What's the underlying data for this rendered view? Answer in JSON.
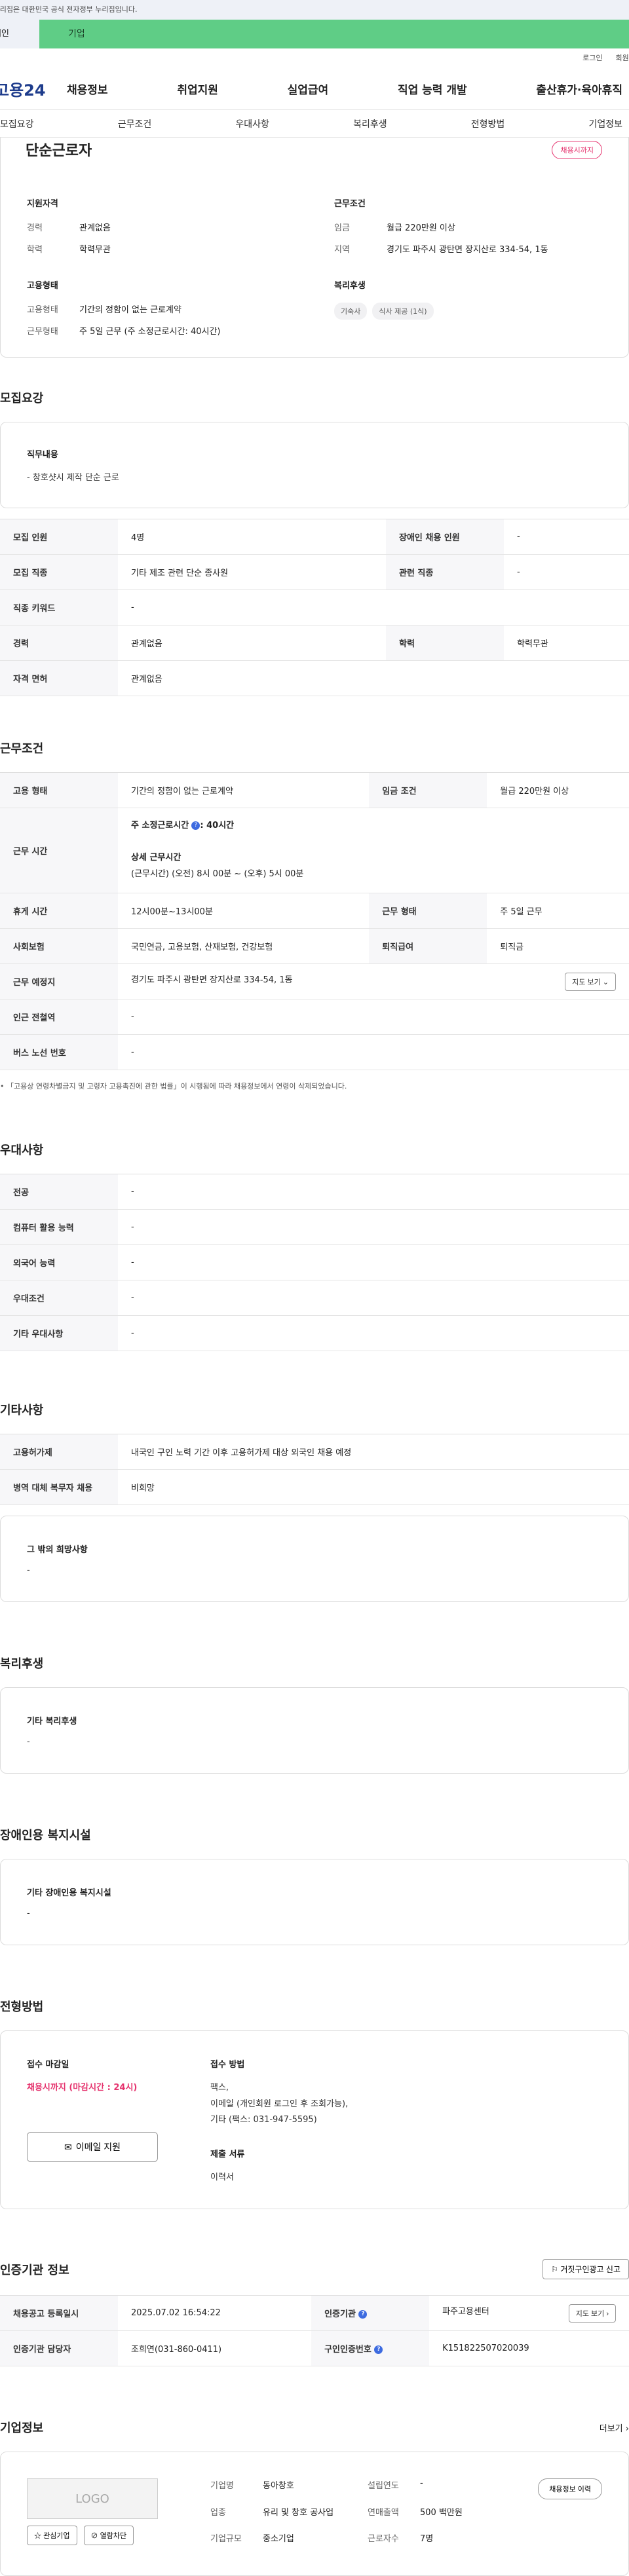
{
  "gov_banner": "이 누리집은 대한민국 공식 전자정부 누리집입니다.",
  "tabs": {
    "personal": "개인",
    "company": "기업"
  },
  "util": {
    "login": "로그인",
    "signup": "회원가입"
  },
  "logo": "고용24",
  "gnb": [
    "채용정보",
    "취업지원",
    "실업급여",
    "직업 능력 개발",
    "출산휴가·육아휴직"
  ],
  "subnav": [
    "모집요강",
    "근무조건",
    "우대사항",
    "복리후생",
    "전형방법",
    "기업정보"
  ],
  "summary": {
    "title": "단순근로자",
    "deadline_badge": "채용시까지",
    "qual_heading": "지원자격",
    "qual": [
      {
        "k": "경력",
        "v": "관계없음"
      },
      {
        "k": "학력",
        "v": "학력무관"
      }
    ],
    "cond_heading": "근무조건",
    "cond": [
      {
        "k": "임금",
        "v": "월급 220만원 이상"
      },
      {
        "k": "지역",
        "v": "경기도 파주시 광탄면 장지산로 334-54, 1동"
      }
    ],
    "emp_heading": "고용형태",
    "emp": [
      {
        "k": "고용형태",
        "v": "기간의 정함이 없는 근로계약"
      },
      {
        "k": "근무형태",
        "v": "주 5일 근무 (주 소정근로시간: 40시간)"
      }
    ],
    "welfare_heading": "복리후생",
    "welfare_chips": [
      "기숙사",
      "식사 제공 (1식)"
    ]
  },
  "recruit": {
    "heading": "모집요강",
    "job_desc_label": "직무내용",
    "job_desc": "- 창호샷시 제작 단순 근로",
    "rows": [
      {
        "k1": "모집 인원",
        "v1": "4명",
        "k2": "장애인 채용 인원",
        "v2": "-"
      },
      {
        "k1": "모집 직종",
        "v1": "기타 제조 관련 단순 종사원",
        "k2": "관련 직종",
        "v2": "-"
      },
      {
        "k1": "직종 키워드",
        "v1": "-"
      },
      {
        "k1": "경력",
        "v1": "관계없음",
        "k2": "학력",
        "v2": "학력무관"
      },
      {
        "k1": "자격 면허",
        "v1": "관계없음"
      }
    ]
  },
  "work": {
    "heading": "근무조건",
    "emp_type_k": "고용 형태",
    "emp_type_v": "기간의 정함이 없는 근로계약",
    "wage_k": "임금 조건",
    "wage_v": "월급 220만원 이상",
    "hours_k": "근무 시간",
    "hours_week": "주 소정근로시간",
    "hours_week_v": ": 40시간",
    "hours_detail_label": "상세 근무시간",
    "hours_detail": "(근무시간) (오전) 8시 00분 ~ (오후) 5시 00분",
    "break_k": "휴게 시간",
    "break_v": "12시00분~13시00분",
    "form_k": "근무 형태",
    "form_v": "주 5일 근무",
    "ins_k": "사회보험",
    "ins_v": "국민연금, 고용보험, 산재보험, 건강보험",
    "retire_k": "퇴직급여",
    "retire_v": "퇴직금",
    "place_k": "근무 예정지",
    "place_v": "경기도 파주시 광탄면 장지산로 334-54, 1동",
    "map_btn": "지도 보기",
    "station_k": "인근 전철역",
    "station_v": "-",
    "bus_k": "버스 노선 번호",
    "bus_v": "-",
    "note": "「고용상 연령차별금지 및 고령자 고용촉진에 관한 법률」이 시행됨에 따라 채용정보에서 연령이 삭제되었습니다."
  },
  "pref": {
    "heading": "우대사항",
    "rows": [
      {
        "k": "전공",
        "v": "-"
      },
      {
        "k": "컴퓨터 활용 능력",
        "v": "-"
      },
      {
        "k": "외국어 능력",
        "v": "-"
      },
      {
        "k": "우대조건",
        "v": "-"
      },
      {
        "k": "기타 우대사항",
        "v": "-"
      }
    ]
  },
  "etc": {
    "heading": "기타사항",
    "rows": [
      {
        "k": "고용허가제",
        "v": "내국인 구인 노력 기간 이후 고용허가제 대상 외국인 채용 예정"
      },
      {
        "k": "병역 대체 복무자 채용",
        "v": "비희망"
      }
    ],
    "other_label": "그 밖의 희망사항",
    "other_v": "-"
  },
  "welfare": {
    "heading": "복리후생",
    "label": "기타 복리후생",
    "v": "-"
  },
  "disabled": {
    "heading": "장애인용 복지시설",
    "label": "기타 장애인용 복지시설",
    "v": "-"
  },
  "process": {
    "heading": "전형방법",
    "deadline_label": "접수 마감일",
    "deadline_v": "채용시까지 (마감시간 : 24시)",
    "email_btn": "이메일 지원",
    "method_label": "접수 방법",
    "method_lines": [
      "팩스,",
      "이메일 (개인회원 로그인 후 조회가능),",
      "기타 (팩스: 031-947-5595)"
    ],
    "docs_label": "제출 서류",
    "docs_v": "이력서"
  },
  "agency": {
    "heading": "인증기관 정보",
    "report_btn": "거짓구인광고 신고",
    "reg_k": "채용공고 등록일시",
    "reg_v": "2025.07.02 16:54:22",
    "org_k": "인증기관",
    "org_v": "파주고용센터",
    "map_btn": "지도 보기",
    "staff_k": "인증기관 담당자",
    "staff_v": "조희연(031-860-0411)",
    "no_k": "구인인증번호",
    "no_v": "K151822507020039"
  },
  "company": {
    "heading": "기업정보",
    "more": "더보기",
    "logo_text": "LOGO",
    "fav_btn": "관심기업",
    "hide_btn": "열람차단",
    "name_k": "기업명",
    "name_v": "동아창호",
    "ind_k": "업종",
    "ind_v": "유리 및 창호 공사업",
    "size_k": "기업규모",
    "size_v": "중소기업",
    "year_k": "설립연도",
    "year_v": "-",
    "sales_k": "연매출액",
    "sales_v": "500 백만원",
    "emp_k": "근로자수",
    "emp_v": "7명",
    "job_btn": "채용정보 이력"
  }
}
